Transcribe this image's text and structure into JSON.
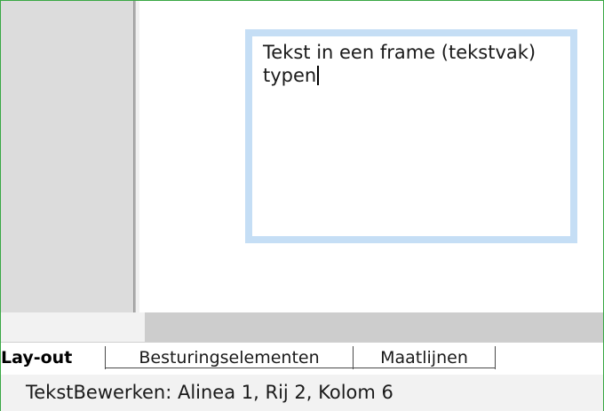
{
  "document": {
    "frame_text_line1": "Tekst in een frame (tekstvak)",
    "frame_text_line2": "typen",
    "frame_border_color": "#c5def5"
  },
  "tabs": [
    {
      "label": "Lay-out",
      "active": true
    },
    {
      "label": "Besturingselementen",
      "active": false
    },
    {
      "label": "Maatlijnen",
      "active": false
    }
  ],
  "statusbar": {
    "text": "TekstBewerken: Alinea 1, Rij 2, Kolom 6"
  },
  "colors": {
    "window_border": "#3aa845",
    "margin_gray": "#dcdcdc",
    "scroll_track": "#cdcdcd"
  }
}
